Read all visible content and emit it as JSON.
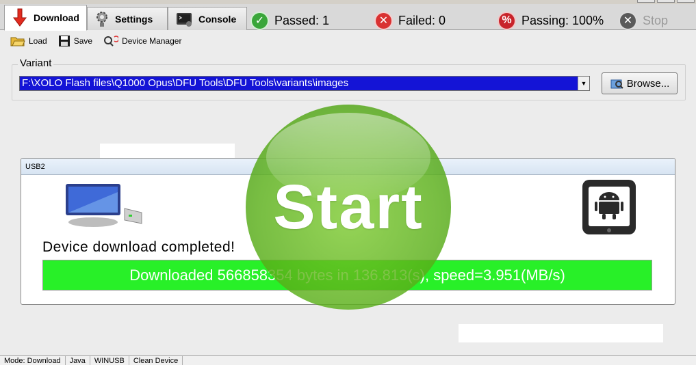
{
  "tabs": [
    {
      "label": "Download",
      "icon": "download-arrow-icon"
    },
    {
      "label": "Settings",
      "icon": "settings-gear-icon"
    },
    {
      "label": "Console",
      "icon": "console-icon"
    }
  ],
  "status": {
    "passed": "Passed: 1",
    "failed": "Failed: 0",
    "passing": "Passing: 100%",
    "stop": "Stop"
  },
  "toolbar": {
    "load": "Load",
    "save": "Save",
    "device_manager": "Device Manager"
  },
  "variant": {
    "label": "Variant",
    "path": "F:\\XOLO Flash files\\Q1000 Opus\\DFU Tools\\DFU Tools\\variants\\images",
    "browse": "Browse..."
  },
  "usb": {
    "title": "USB2",
    "message": "Device download completed!",
    "progress_text": "Downloaded 566858354 bytes in 136.813(s), speed=3.951(MB/s)",
    "progress_percent": 100
  },
  "start_label": "Start",
  "statusbar": [
    "Mode: Download",
    "Java",
    "WINUSB",
    "Clean Device"
  ],
  "colors": {
    "variant_bg": "#1414d6",
    "progress": "#28f028",
    "passed": "#3aa63a",
    "failed": "#d93232",
    "passing": "#c8232a",
    "stop": "#5a5a5a",
    "start": "#6fbf2a"
  }
}
